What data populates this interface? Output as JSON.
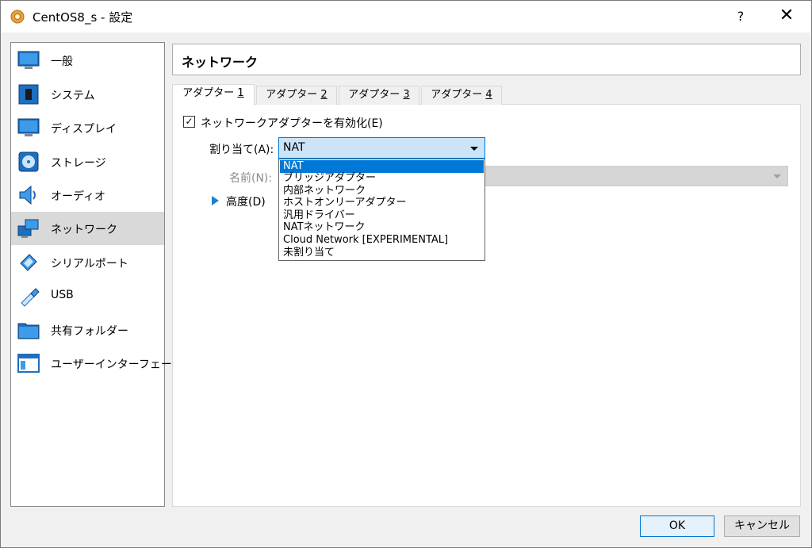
{
  "window": {
    "title": "CentOS8_s - 設定",
    "help_label": "?",
    "close_label": "✕"
  },
  "sidebar": {
    "items": [
      {
        "label": "一般",
        "icon": "general-icon"
      },
      {
        "label": "システム",
        "icon": "system-icon"
      },
      {
        "label": "ディスプレイ",
        "icon": "display-icon"
      },
      {
        "label": "ストレージ",
        "icon": "storage-icon"
      },
      {
        "label": "オーディオ",
        "icon": "audio-icon"
      },
      {
        "label": "ネットワーク",
        "icon": "network-icon",
        "selected": true
      },
      {
        "label": "シリアルポート",
        "icon": "serial-port-icon"
      },
      {
        "label": "USB",
        "icon": "usb-icon"
      },
      {
        "label": "共有フォルダー",
        "icon": "shared-folder-icon"
      },
      {
        "label": "ユーザーインターフェース",
        "icon": "user-interface-icon"
      }
    ]
  },
  "header": {
    "title": "ネットワーク"
  },
  "tabs": [
    {
      "label": "アダプター ",
      "num": "1",
      "active": true
    },
    {
      "label": "アダプター ",
      "num": "2"
    },
    {
      "label": "アダプター ",
      "num": "3"
    },
    {
      "label": "アダプター ",
      "num": "4"
    }
  ],
  "adapter": {
    "enable_label": "ネットワークアダプターを有効化(E)",
    "enabled": true,
    "attach_label": "割り当て(A):",
    "attach_value": "NAT",
    "name_label": "名前(N):",
    "advanced_label": "高度(D)"
  },
  "dropdown": {
    "options": [
      "NAT",
      "ブリッジアダプター",
      "内部ネットワーク",
      "ホストオンリーアダプター",
      "汎用ドライバー",
      "NATネットワーク",
      "Cloud Network [EXPERIMENTAL]",
      "未割り当て"
    ],
    "selected_index": 0
  },
  "buttons": {
    "ok": "OK",
    "cancel": "キャンセル"
  },
  "colors": {
    "accent": "#0078d7",
    "selected_sidebar": "#d9d9d9",
    "combo_bg": "#cce4f7"
  }
}
